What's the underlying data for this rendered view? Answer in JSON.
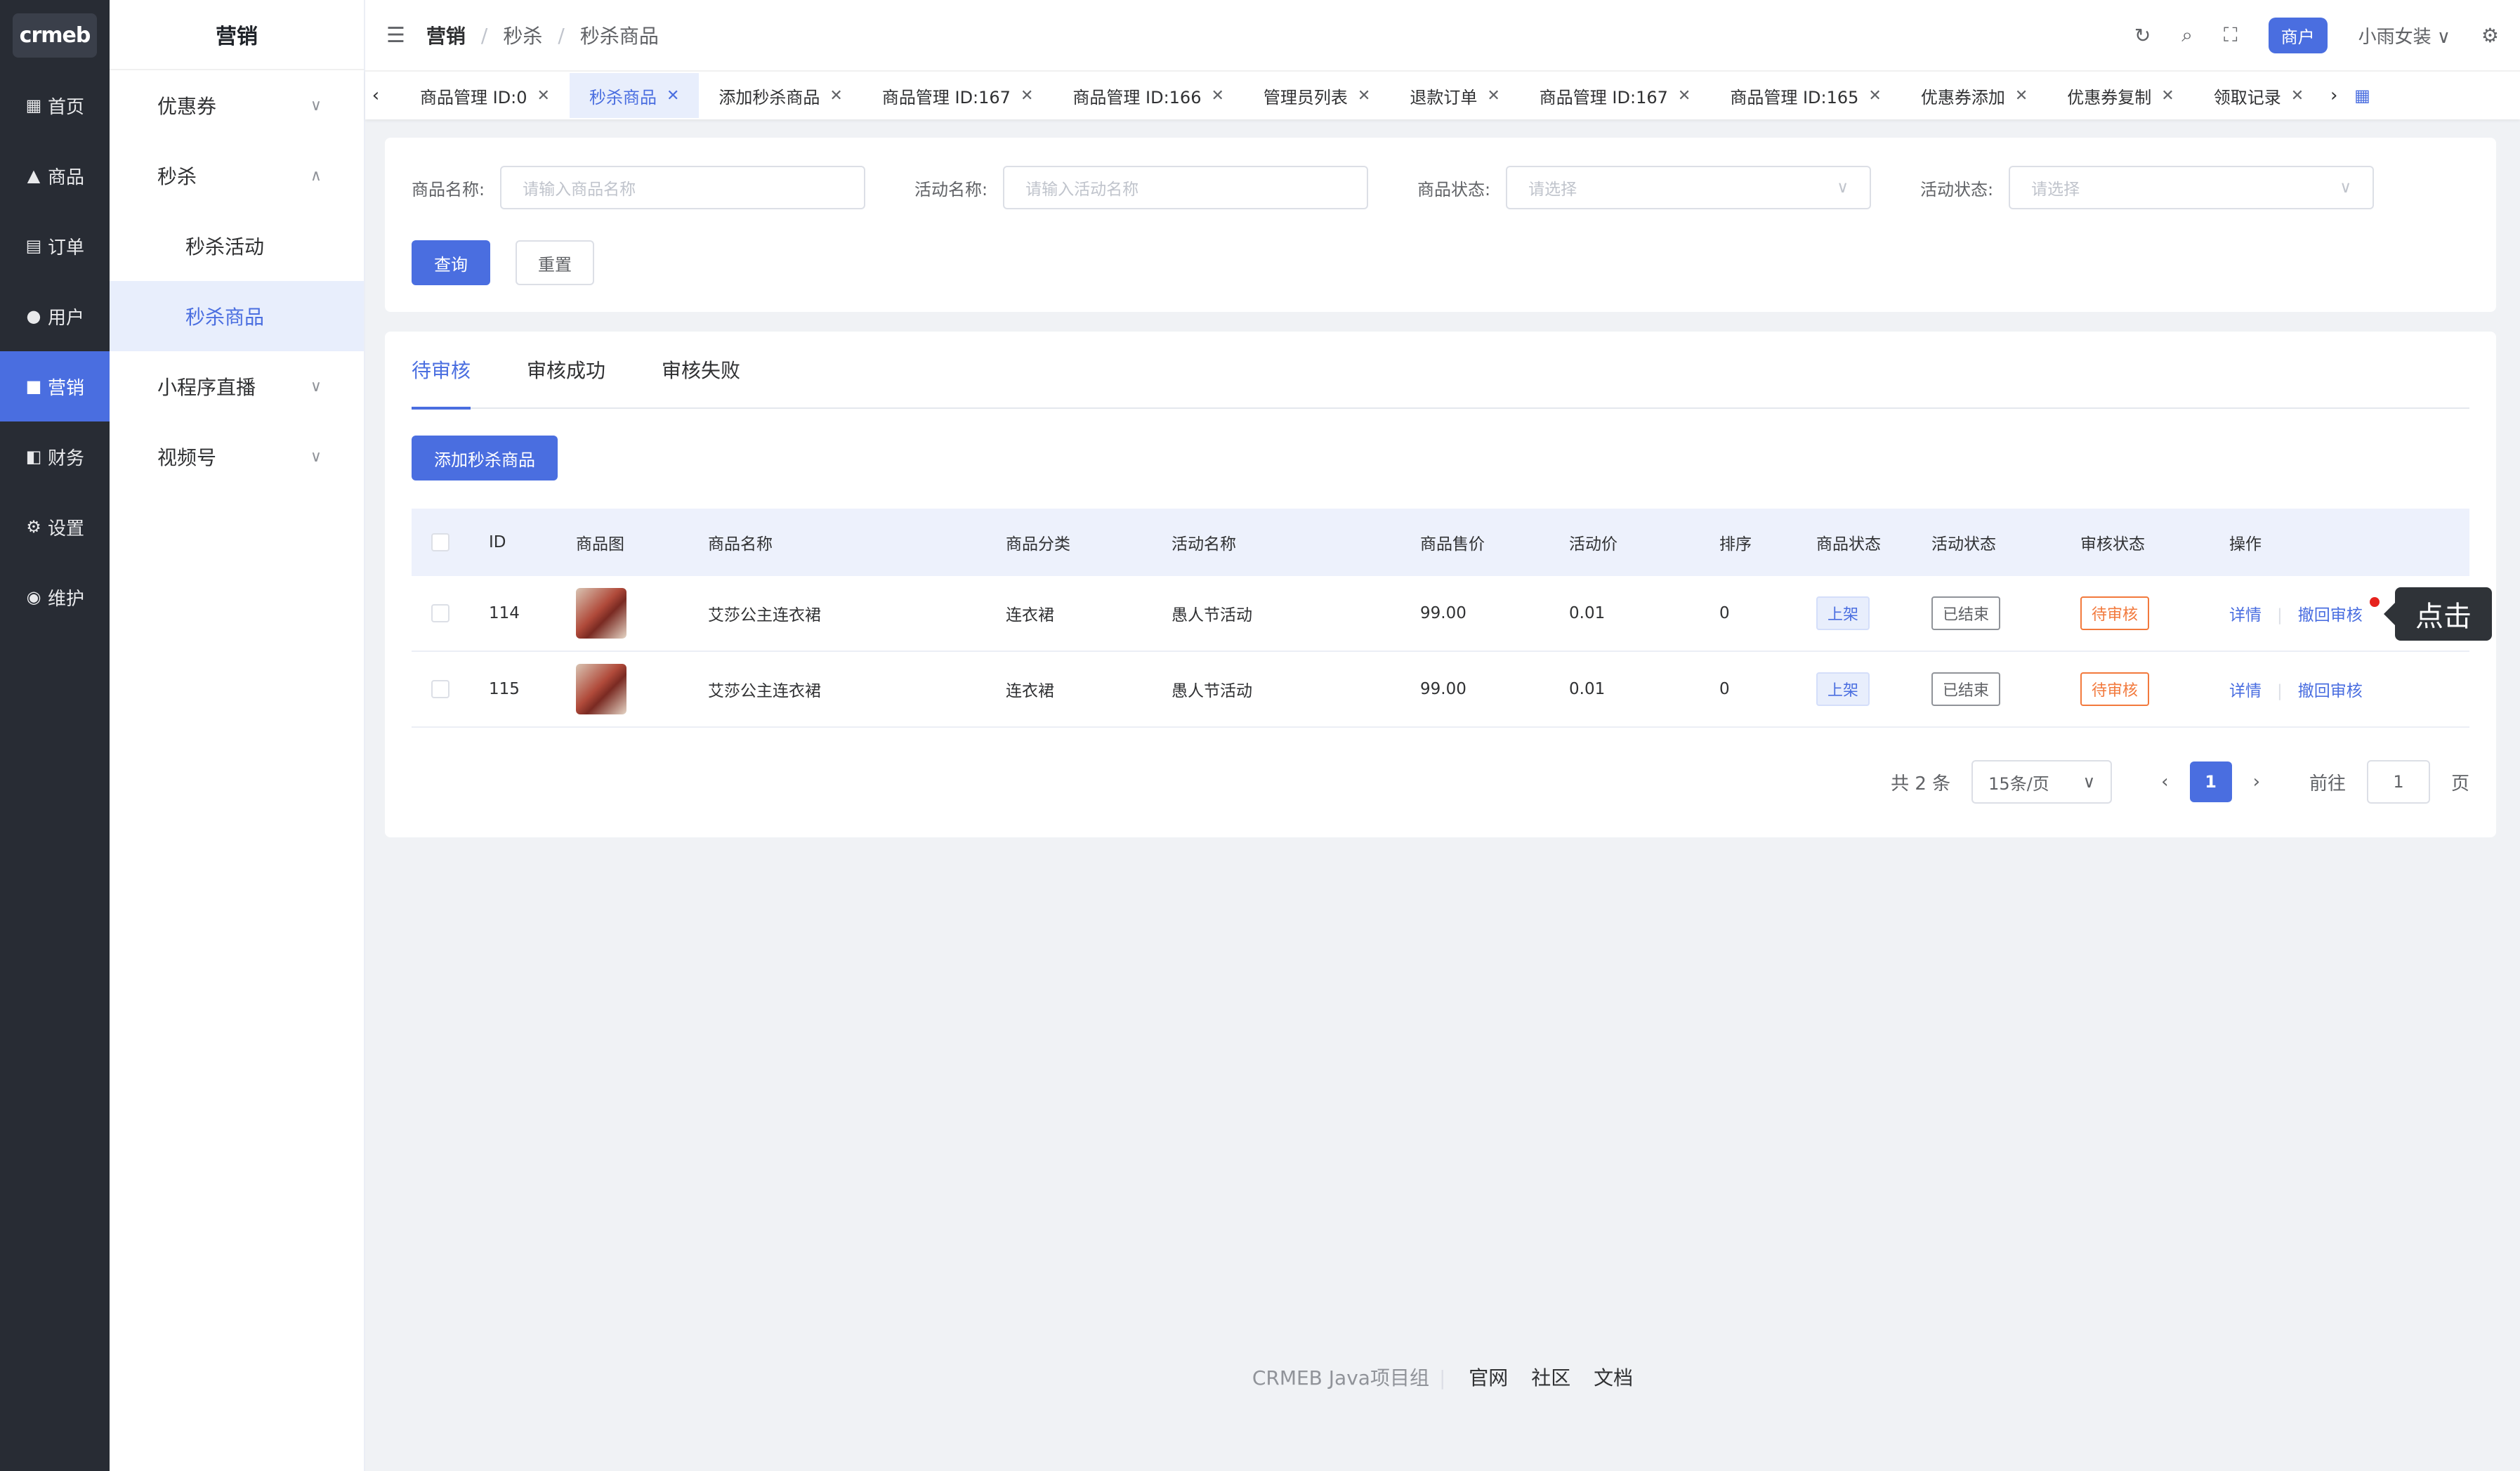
{
  "logo": "crmeb",
  "rail": [
    {
      "label": "首页",
      "icon": "grid-icon"
    },
    {
      "label": "商品",
      "icon": "bag-icon"
    },
    {
      "label": "订单",
      "icon": "clipboard-icon"
    },
    {
      "label": "用户",
      "icon": "user-icon"
    },
    {
      "label": "营销",
      "icon": "ticket-icon"
    },
    {
      "label": "财务",
      "icon": "wallet-icon"
    },
    {
      "label": "设置",
      "icon": "gear-icon"
    },
    {
      "label": "维护",
      "icon": "tool-icon"
    }
  ],
  "sidebar": {
    "title": "营销",
    "items": [
      {
        "label": "优惠券"
      },
      {
        "label": "秒杀"
      },
      {
        "label": "秒杀活动"
      },
      {
        "label": "秒杀商品"
      },
      {
        "label": "小程序直播"
      },
      {
        "label": "视频号"
      }
    ]
  },
  "header": {
    "breadcrumb": [
      "营销",
      "秒杀",
      "秒杀商品"
    ],
    "merchant": "商户",
    "user": "小雨女装"
  },
  "tabs": [
    "商品管理 ID:0",
    "秒杀商品",
    "添加秒杀商品",
    "商品管理 ID:167",
    "商品管理 ID:166",
    "管理员列表",
    "退款订单",
    "商品管理 ID:167",
    "商品管理 ID:165",
    "优惠券添加",
    "优惠券复制",
    "领取记录"
  ],
  "search": {
    "product_name_label": "商品名称:",
    "product_name_placeholder": "请输入商品名称",
    "activity_name_label": "活动名称:",
    "activity_name_placeholder": "请输入活动名称",
    "product_status_label": "商品状态:",
    "product_status_placeholder": "请选择",
    "activity_status_label": "活动状态:",
    "activity_status_placeholder": "请选择",
    "query": "查询",
    "reset": "重置"
  },
  "list_tabs": [
    "待审核",
    "审核成功",
    "审核失败"
  ],
  "add_button": "添加秒杀商品",
  "table": {
    "columns": [
      "ID",
      "商品图",
      "商品名称",
      "商品分类",
      "活动名称",
      "商品售价",
      "活动价",
      "排序",
      "商品状态",
      "活动状态",
      "审核状态",
      "操作"
    ],
    "rows": [
      {
        "id": "114",
        "name": "艾莎公主连衣裙",
        "category": "连衣裙",
        "activity": "愚人节活动",
        "price": "99.00",
        "act_price": "0.01",
        "sort": "0",
        "product_status": "上架",
        "activity_status": "已结束",
        "audit_status": "待审核",
        "op_detail": "详情",
        "op_withdraw": "撤回审核"
      },
      {
        "id": "115",
        "name": "艾莎公主连衣裙",
        "category": "连衣裙",
        "activity": "愚人节活动",
        "price": "99.00",
        "act_price": "0.01",
        "sort": "0",
        "product_status": "上架",
        "activity_status": "已结束",
        "audit_status": "待审核",
        "op_detail": "详情",
        "op_withdraw": "撤回审核"
      }
    ]
  },
  "pager": {
    "total": "共 2 条",
    "page_size": "15条/页",
    "current": "1",
    "goto_label": "前往",
    "goto_value": "1",
    "page_suffix": "页"
  },
  "tooltip": "点击",
  "footer": {
    "text": "CRMEB Java项目组",
    "links": [
      "官网",
      "社区",
      "文档"
    ]
  },
  "colors": {
    "primary": "#4a6ee0",
    "rail": "#282c34",
    "warning": "#f2793c"
  }
}
